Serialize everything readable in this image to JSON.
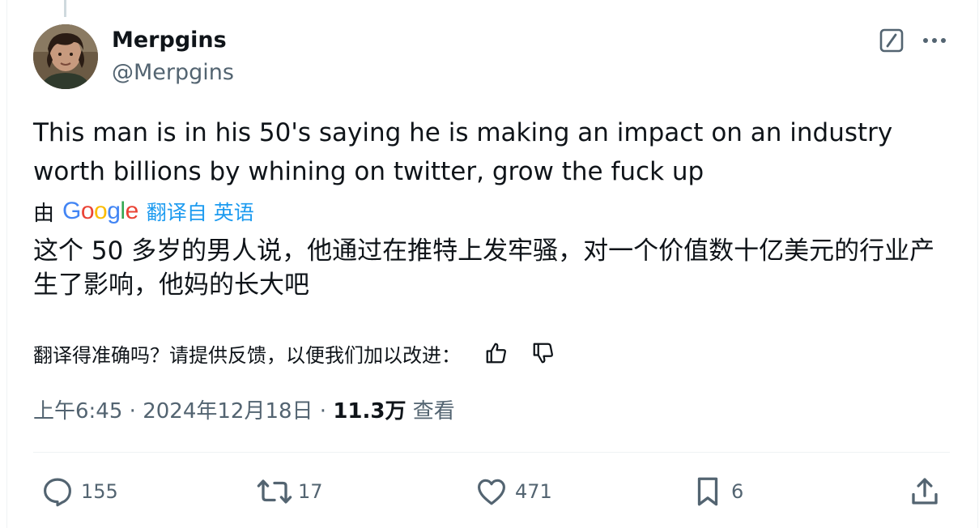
{
  "tweet": {
    "author": {
      "display_name": "Merpgins",
      "handle": "@Merpgins"
    },
    "text": "This man is in his 50's saying he is making an impact on an industry worth billions by whining on twitter, grow the fuck up",
    "translation": {
      "prefix": "由",
      "provider": "Google",
      "link_text": "翻译自 英语",
      "text": "这个 50 多岁的男人说，他通过在推特上发牢骚，对一个价值数十亿美元的行业产生了影响，他妈的长大吧"
    },
    "feedback": {
      "prompt": "翻译得准确吗？请提供反馈，以便我们加以改进："
    },
    "meta": {
      "time": "上午6:45",
      "date": "2024年12月18日",
      "views_count": "11.3万",
      "views_label": "查看",
      "separator": "·"
    },
    "actions": {
      "replies": "155",
      "reposts": "17",
      "likes": "471",
      "bookmarks": "6"
    }
  },
  "icons": [
    "grok-icon",
    "more-icon",
    "thumbs-up-icon",
    "thumbs-down-icon",
    "reply-icon",
    "repost-icon",
    "like-icon",
    "bookmark-icon",
    "share-icon"
  ],
  "colors": {
    "text": "#0f1419",
    "secondary": "#536471",
    "link": "#1d9bf0",
    "border": "#eff3f4"
  }
}
